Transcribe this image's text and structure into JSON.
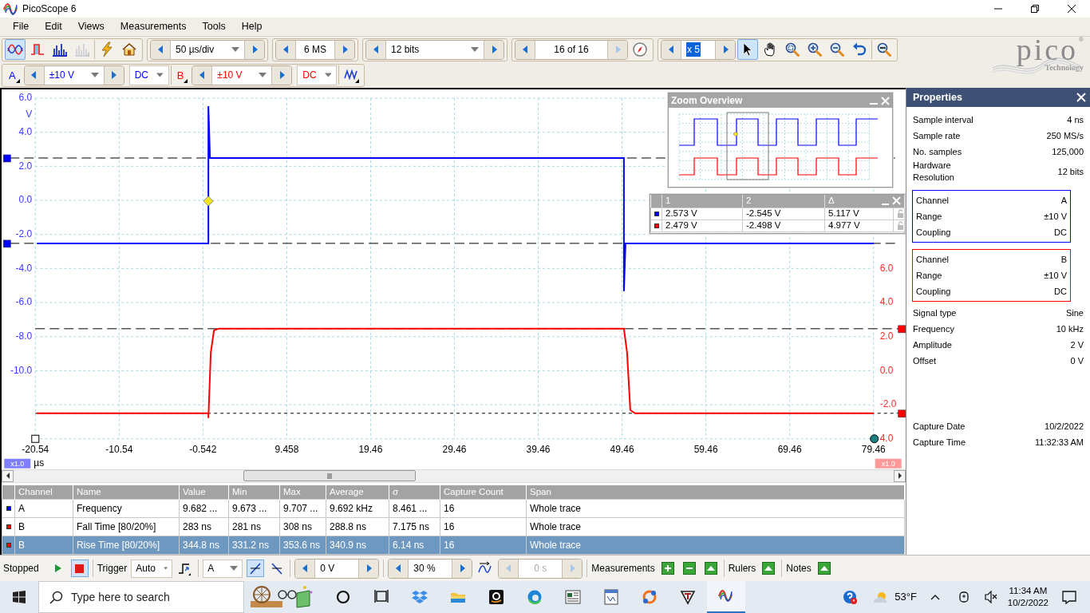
{
  "window": {
    "title": "PicoScope 6"
  },
  "menu": [
    {
      "label": "File"
    },
    {
      "label": "Edit"
    },
    {
      "label": "Views"
    },
    {
      "label": "Measurements"
    },
    {
      "label": "Tools"
    },
    {
      "label": "Help"
    }
  ],
  "toolbar": {
    "modes": [
      {
        "kind": "scope",
        "selected": true,
        "disabled": false
      },
      {
        "kind": "persistence",
        "selected": false,
        "disabled": false
      },
      {
        "kind": "spectrum",
        "selected": false,
        "disabled": false
      },
      {
        "kind": "spectrum",
        "selected": false,
        "disabled": true
      }
    ],
    "timebase": "50 µs/div",
    "samples": "6 MS",
    "resolution": "12 bits",
    "buffer": {
      "value": "16 of 16",
      "next_disabled": true
    },
    "zoom": {
      "value": "x 5",
      "selected": true
    },
    "tools": [
      {
        "kind": "pointer",
        "selected": true
      },
      {
        "kind": "hand",
        "selected": false
      },
      {
        "kind": "zoom-box",
        "selected": false
      },
      {
        "kind": "zoom-in",
        "selected": false
      },
      {
        "kind": "zoom-out",
        "selected": false
      },
      {
        "kind": "undo",
        "selected": false
      },
      {
        "kind": "zoom-100",
        "selected": false
      }
    ]
  },
  "logo": {
    "name": "pico",
    "mark": "®",
    "tagline": "Technology"
  },
  "channels": [
    {
      "name": "A",
      "color": "#0000ff",
      "range": "±10 V",
      "coupling": "DC"
    },
    {
      "name": "B",
      "color": "#ff0000",
      "range": "±10 V",
      "coupling": "DC"
    }
  ],
  "plot": {
    "y_unit": "V",
    "y_ticks": [
      "6.0",
      "4.0",
      "2.0",
      "0.0",
      "-2.0",
      "-4.0",
      "-6.0",
      "-8.0",
      "-10.0"
    ],
    "y2_ticks": [
      "6.0",
      "4.0",
      "2.0",
      "0.0",
      "-2.0",
      "4.0"
    ],
    "x_ticks": [
      "-20.54",
      "-10.54",
      "-0.542",
      "9.458",
      "19.46",
      "29.46",
      "39.46",
      "49.46",
      "59.46",
      "69.46",
      "79.46"
    ],
    "x_unit": "µs",
    "scales": [
      {
        "label": "x1.0",
        "color": "#8080ff"
      },
      {
        "label": "x1.0",
        "color": "#ff9999"
      }
    ]
  },
  "zoom_overview": {
    "title": "Zoom Overview"
  },
  "cursors": {
    "columns": [
      "1",
      "2",
      "Δ"
    ],
    "rows": [
      {
        "color": "#0000ff",
        "values": [
          "2.573 V",
          "-2.545 V",
          "5.117 V"
        ]
      },
      {
        "color": "#ff0000",
        "values": [
          "2.479 V",
          "-2.498 V",
          "4.977 V"
        ]
      }
    ]
  },
  "measurements": {
    "columns": [
      "Channel",
      "Name",
      "Value",
      "Min",
      "Max",
      "Average",
      "σ",
      "Capture Count",
      "Span"
    ],
    "rows": [
      {
        "color": "#0000ff",
        "selected": false,
        "cells": [
          "A",
          "Frequency",
          "9.682 ...",
          "9.673 ...",
          "9.707 ...",
          "9.692 kHz",
          "8.461 ...",
          "16",
          "Whole trace"
        ]
      },
      {
        "color": "#ff0000",
        "selected": false,
        "cells": [
          "B",
          "Fall Time [80/20%]",
          "283 ns",
          "281 ns",
          "308 ns",
          "288.8 ns",
          "7.175 ns",
          "16",
          "Whole trace"
        ]
      },
      {
        "color": "#ff0000",
        "selected": true,
        "cells": [
          "B",
          "Rise Time [80/20%]",
          "344.8 ns",
          "331.2 ns",
          "353.6 ns",
          "340.9 ns",
          "6.14 ns",
          "16",
          "Whole trace"
        ]
      }
    ]
  },
  "properties": {
    "title": "Properties",
    "groups": [
      {
        "rows": [
          {
            "label": "Sample interval",
            "value": "4 ns"
          },
          {
            "label": "Sample rate",
            "value": "250 MS/s"
          },
          {
            "label": "No. samples",
            "value": "125,000"
          },
          {
            "label": "Hardware Resolution",
            "value": "12 bits"
          }
        ]
      },
      {
        "color": "#0000ff",
        "rows": [
          {
            "label": "Channel",
            "value": "A"
          },
          {
            "label": "Range",
            "value": "±10 V"
          },
          {
            "label": "Coupling",
            "value": "DC"
          }
        ]
      },
      {
        "color": "#ff0000",
        "rows": [
          {
            "label": "Channel",
            "value": "B"
          },
          {
            "label": "Range",
            "value": "±10 V"
          },
          {
            "label": "Coupling",
            "value": "DC"
          }
        ]
      },
      {
        "rows": [
          {
            "label": "Signal type",
            "value": "Sine"
          },
          {
            "label": "Frequency",
            "value": "10 kHz"
          },
          {
            "label": "Amplitude",
            "value": "2 V"
          },
          {
            "label": "Offset",
            "value": "0 V"
          }
        ]
      },
      {
        "rows": [
          {
            "label": "Capture Date",
            "value": "10/2/2022"
          },
          {
            "label": "Capture Time",
            "value": "11:32:33 AM"
          }
        ]
      }
    ]
  },
  "status": {
    "state": "Stopped",
    "running": false,
    "trigger_label": "Trigger",
    "trigger_mode": "Auto",
    "trigger_channel": "A",
    "edges": [
      {
        "kind": "rising",
        "selected": true
      },
      {
        "kind": "falling",
        "selected": false
      }
    ],
    "threshold": "0 V",
    "pretrigger": "30 %",
    "delay": "0 s",
    "delay_disabled": true,
    "panels": [
      {
        "label": "Measurements",
        "buttons": [
          {
            "kind": "add"
          },
          {
            "kind": "remove"
          },
          {
            "kind": "up"
          }
        ]
      },
      {
        "label": "Rulers",
        "buttons": [
          {
            "kind": "up"
          }
        ]
      },
      {
        "label": "Notes",
        "buttons": [
          {
            "kind": "up"
          }
        ]
      }
    ]
  },
  "taskbar": {
    "search_placeholder": "Type here to search",
    "apps": [
      {
        "kind": "circle",
        "active": false
      },
      {
        "kind": "taskview",
        "active": false
      },
      {
        "kind": "diamonds",
        "active": false
      },
      {
        "kind": "folder",
        "active": false
      },
      {
        "kind": "shop",
        "active": false
      },
      {
        "kind": "browser",
        "active": false
      },
      {
        "kind": "news",
        "active": false
      },
      {
        "kind": "doc",
        "active": false
      },
      {
        "kind": "ring",
        "active": false
      },
      {
        "kind": "lt",
        "active": false
      },
      {
        "kind": "scope",
        "active": true
      }
    ],
    "temperature": "53°F",
    "time": "11:34 AM",
    "date": "10/2/2022"
  }
}
